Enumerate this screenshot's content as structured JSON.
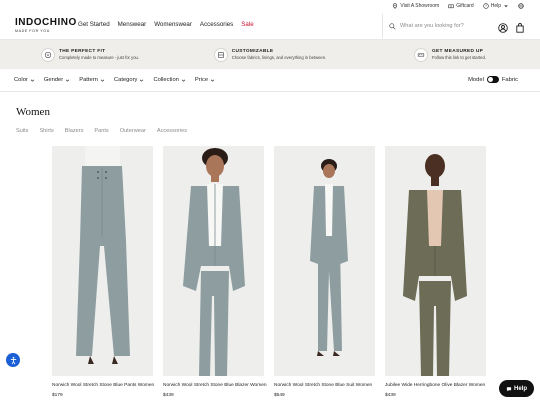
{
  "utility": {
    "showroom": "Visit A Showroom",
    "giftcard": "Giftcard",
    "help": "Help"
  },
  "header": {
    "brand": "INDOCHINO",
    "tagline": "MADE FOR YOU",
    "nav": [
      "Get Started",
      "Menswear",
      "Womenswear",
      "Accessories",
      "Sale"
    ],
    "search_placeholder": "What are you looking for?"
  },
  "promos": [
    {
      "title": "THE PERFECT FIT",
      "sub": "Completely made to measure - just for you."
    },
    {
      "title": "CUSTOMIZABLE",
      "sub": "Choose fabrics, linings, and everything in between."
    },
    {
      "title": "GET MEASURED UP",
      "sub": "Follow this link to get started."
    }
  ],
  "filters": [
    "Color",
    "Gender",
    "Pattern",
    "Category",
    "Collection",
    "Price"
  ],
  "view_toggle": {
    "left": "Model",
    "right": "Fabric"
  },
  "page": {
    "title": "Women",
    "subcategories": [
      "Suits",
      "Shirts",
      "Blazers",
      "Pants",
      "Outerwear",
      "Accessories"
    ]
  },
  "products": [
    {
      "name": "Norwich Wool Stretch Stone Blue Pants Women",
      "price": "$179",
      "color": "#8e9ea0"
    },
    {
      "name": "Norwich Wool Stretch Stone Blue Blazer Women",
      "price": "$439",
      "color": "#8e9ea0"
    },
    {
      "name": "Norwich Wool Stretch Stone Blue Suit Women",
      "price": "$549",
      "color": "#8e9ea0"
    },
    {
      "name": "Jubilee Wide Herringbone Olive Blazer Women",
      "price": "$439",
      "color": "#6c6c57"
    }
  ],
  "help_button": "Help",
  "colors": {
    "sale": "#c8102e",
    "promo_bg": "#efeeeb",
    "accessibility": "#1b5fd6"
  }
}
